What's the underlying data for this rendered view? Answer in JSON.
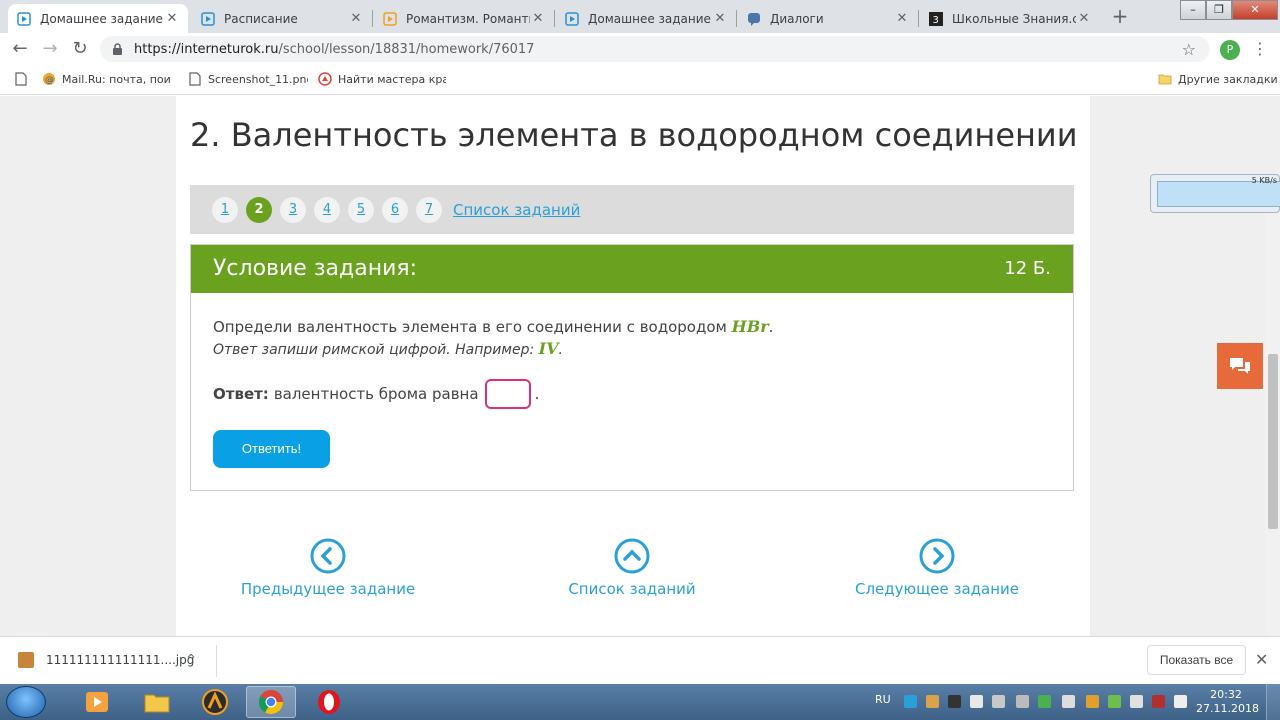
{
  "tabs": [
    {
      "title": "Домашнее задание - Х",
      "active": true
    },
    {
      "title": "Расписание",
      "active": false
    },
    {
      "title": "Романтизм. Романтиче",
      "active": false
    },
    {
      "title": "Домашнее задание - Ф",
      "active": false
    },
    {
      "title": "Диалоги",
      "active": false
    },
    {
      "title": "Школьные Знания.com",
      "active": false
    }
  ],
  "toolbar": {
    "url_host": "https://interneturok.ru",
    "url_path": "/school/lesson/18831/homework/76017",
    "profile_initial": "P"
  },
  "bookmarks": [
    {
      "label": "Mail.Ru: почта, поис"
    },
    {
      "label": "Screenshot_11.png"
    },
    {
      "label": "Найти мастера крас"
    }
  ],
  "bookmarks_other": "Другие закладки",
  "lesson": {
    "title": "2. Валентность элемента в водородном соединении",
    "steps": [
      "1",
      "2",
      "3",
      "4",
      "5",
      "6",
      "7"
    ],
    "active_step": "2",
    "task_list_link": "Список заданий"
  },
  "task": {
    "header": "Условие задания:",
    "points": "12 Б.",
    "condition_text": "Определи валентность элемента в его соединении с водородом ",
    "condition_formula": "HBr",
    "condition_end": ".",
    "hint_text": "Ответ запиши римской цифрой. Например: ",
    "hint_example": "IV",
    "hint_end": ".",
    "answer_label": "Ответ:",
    "answer_text": "валентность брома равна",
    "answer_value": "",
    "answer_end": ".",
    "submit_label": "Ответить!"
  },
  "nav": {
    "prev": "Предыдущее задание",
    "list": "Список заданий",
    "next": "Следующее задание"
  },
  "net_widget": {
    "rate": "5 KB/s"
  },
  "download": {
    "filename": "111111111111111....jpg",
    "show_all": "Показать все"
  },
  "taskbar": {
    "lang": "RU",
    "time": "20:32",
    "date": "27.11.2018"
  },
  "colors": {
    "accent_green": "#6aa220",
    "link_blue": "#2aa0d6",
    "submit_blue": "#0aa0e6",
    "input_border": "#d6337a",
    "chat_orange": "#e76a3a"
  }
}
